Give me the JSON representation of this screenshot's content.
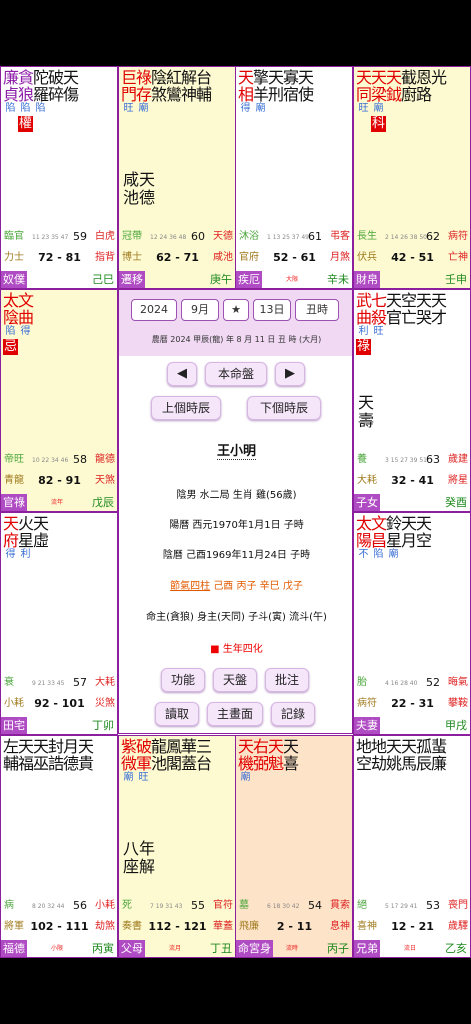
{
  "palaces": [
    {
      "stars": [
        {
          "c": "廉貞",
          "t": "purple",
          "b": "陷"
        },
        {
          "c": "貪狼",
          "t": "purple",
          "b": "陷",
          "h": "權"
        },
        {
          "c": "陀羅",
          "t": "black",
          "b": "陷"
        },
        {
          "c": "破碎",
          "t": "black",
          "b": ""
        },
        {
          "c": "天傷",
          "t": "black",
          "b": ""
        }
      ],
      "minor": "",
      "stage": "臨官",
      "ages": "11 23 35 47",
      "age": "59",
      "god1": "白虎",
      "doc": "力士",
      "range": "72 - 81",
      "god2": "指背",
      "palace": "奴僕",
      "mid": "",
      "gz": "己巳",
      "bg": "white"
    },
    {
      "stars": [
        {
          "c": "巨門",
          "t": "red",
          "b": "旺"
        },
        {
          "c": "祿存",
          "t": "red",
          "b": "廟"
        },
        {
          "c": "陰煞",
          "t": "black",
          "b": ""
        },
        {
          "c": "紅鸞",
          "t": "black",
          "b": ""
        },
        {
          "c": "解神",
          "t": "black",
          "b": ""
        },
        {
          "c": "台輔",
          "t": "black",
          "b": ""
        }
      ],
      "minor": "咸天\n池德",
      "stage": "冠帶",
      "ages": "12 24 36 48",
      "age": "60",
      "god1": "天德",
      "doc": "博士",
      "range": "62 - 71",
      "god2": "咸池",
      "palace": "遷移",
      "mid": "",
      "gz": "庚午",
      "bg": "yellow"
    },
    {
      "stars": [
        {
          "c": "天相",
          "t": "red",
          "b": "得"
        },
        {
          "c": "擎羊",
          "t": "black",
          "b": "廟"
        },
        {
          "c": "天刑",
          "t": "black",
          "b": ""
        },
        {
          "c": "寡宿",
          "t": "black",
          "b": ""
        },
        {
          "c": "天使",
          "t": "black",
          "b": ""
        }
      ],
      "minor": "",
      "stage": "沐浴",
      "ages": "1 13 25 37 49",
      "age": "61",
      "god1": "弔客",
      "doc": "官府",
      "range": "52 - 61",
      "god2": "月煞",
      "palace": "疾厄",
      "mid": "大限",
      "gz": "辛未",
      "bg": "white"
    },
    {
      "stars": [
        {
          "c": "天同",
          "t": "red",
          "b": "旺"
        },
        {
          "c": "天梁",
          "t": "red",
          "b": "廟",
          "h": "科"
        },
        {
          "c": "天鉞",
          "t": "red",
          "b": ""
        },
        {
          "c": "截廚",
          "t": "black",
          "b": ""
        },
        {
          "c": "恩路",
          "t": "black",
          "b": ""
        },
        {
          "c": "光",
          "t": "black",
          "b": ""
        }
      ],
      "minor": "",
      "stage": "長生",
      "ages": "2 14 26 38 50",
      "age": "62",
      "god1": "病符",
      "doc": "伏兵",
      "range": "42 - 51",
      "god2": "亡神",
      "palace": "財帛",
      "mid": "",
      "gz": "壬申",
      "bg": "yellow"
    },
    {
      "stars": [
        {
          "c": "太陰",
          "t": "red",
          "b": "陷",
          "h": "忌"
        },
        {
          "c": "文曲",
          "t": "red",
          "b": "得"
        }
      ],
      "minor": "",
      "stage": "帝旺",
      "ages": "10 22 34 46",
      "age": "58",
      "god1": "龍德",
      "doc": "青龍",
      "range": "82 - 91",
      "god2": "天煞",
      "palace": "官祿",
      "mid": "流年",
      "gz": "戊辰",
      "bg": "yellow"
    },
    {
      "stars": [
        {
          "c": "武曲",
          "t": "red",
          "b": "利",
          "h": "祿"
        },
        {
          "c": "七殺",
          "t": "red",
          "b": "旺"
        },
        {
          "c": "天官",
          "t": "black",
          "b": ""
        },
        {
          "c": "空亡",
          "t": "black",
          "b": ""
        },
        {
          "c": "天哭",
          "t": "black",
          "b": ""
        },
        {
          "c": "天才",
          "t": "black",
          "b": ""
        }
      ],
      "minor": "天\n壽",
      "stage": "養",
      "ages": "3 15 27 39 51",
      "age": "63",
      "god1": "歲建",
      "doc": "大耗",
      "range": "32 - 41",
      "god2": "將星",
      "palace": "子女",
      "mid": "",
      "gz": "癸酉",
      "bg": "white"
    },
    {
      "stars": [
        {
          "c": "天府",
          "t": "red",
          "b": "得"
        },
        {
          "c": "火星",
          "t": "black",
          "b": "利"
        },
        {
          "c": "天虛",
          "t": "black",
          "b": ""
        }
      ],
      "minor": "",
      "stage": "衰",
      "ages": "9 21 33 45",
      "age": "57",
      "god1": "大耗",
      "doc": "小耗",
      "range": "92 - 101",
      "god2": "災煞",
      "palace": "田宅",
      "mid": "",
      "gz": "丁卯",
      "bg": "white"
    },
    {
      "stars": [
        {
          "c": "太陽",
          "t": "red",
          "b": "不"
        },
        {
          "c": "文昌",
          "t": "red",
          "b": "陷"
        },
        {
          "c": "鈴星",
          "t": "black",
          "b": "廟"
        },
        {
          "c": "天月",
          "t": "black",
          "b": ""
        },
        {
          "c": "天空",
          "t": "black",
          "b": ""
        }
      ],
      "minor": "",
      "stage": "胎",
      "ages": "4 16 28 40",
      "age": "52",
      "god1": "晦氣",
      "doc": "病符",
      "range": "22 - 31",
      "god2": "攀鞍",
      "palace": "夫妻",
      "mid": "",
      "gz": "甲戌",
      "bg": "white"
    },
    {
      "stars": [
        {
          "c": "左輔",
          "t": "black",
          "b": ""
        },
        {
          "c": "天福",
          "t": "black",
          "b": ""
        },
        {
          "c": "天巫",
          "t": "black",
          "b": ""
        },
        {
          "c": "封誥",
          "t": "black",
          "b": ""
        },
        {
          "c": "月德",
          "t": "black",
          "b": ""
        },
        {
          "c": "天貴",
          "t": "black",
          "b": ""
        }
      ],
      "minor": "",
      "stage": "病",
      "ages": "8 20 32 44",
      "age": "56",
      "god1": "小耗",
      "doc": "將軍",
      "range": "102 - 111",
      "god2": "劫煞",
      "palace": "福德",
      "mid": "小限",
      "gz": "丙寅",
      "bg": "white"
    },
    {
      "stars": [
        {
          "c": "紫微",
          "t": "red",
          "b": "廟"
        },
        {
          "c": "破軍",
          "t": "red",
          "b": "旺"
        },
        {
          "c": "龍池",
          "t": "black",
          "b": ""
        },
        {
          "c": "鳳閣",
          "t": "black",
          "b": ""
        },
        {
          "c": "華蓋",
          "t": "black",
          "b": ""
        },
        {
          "c": "三台",
          "t": "black",
          "b": ""
        }
      ],
      "minor": "八年\n座解",
      "stage": "死",
      "ages": "7 19 31 43",
      "age": "55",
      "god1": "官符",
      "doc": "奏書",
      "range": "112 - 121",
      "god2": "華蓋",
      "palace": "父母",
      "mid": "流月",
      "gz": "丁丑",
      "bg": "yellow"
    },
    {
      "stars": [
        {
          "c": "天機",
          "t": "red",
          "b": "廟"
        },
        {
          "c": "右弼",
          "t": "red",
          "b": ""
        },
        {
          "c": "天魁",
          "t": "red",
          "b": ""
        },
        {
          "c": "天喜",
          "t": "black",
          "b": ""
        }
      ],
      "minor": "",
      "stage": "墓",
      "ages": "6 18 30 42",
      "age": "54",
      "god1": "貫索",
      "doc": "飛廉",
      "range": "2 - 11",
      "god2": "息神",
      "palace": "命宮身",
      "mid": "流時",
      "gz": "丙子",
      "bg": "orange"
    },
    {
      "stars": [
        {
          "c": "地空",
          "t": "black",
          "b": ""
        },
        {
          "c": "地劫",
          "t": "black",
          "b": ""
        },
        {
          "c": "天姚",
          "t": "black",
          "b": ""
        },
        {
          "c": "天馬",
          "t": "black",
          "b": ""
        },
        {
          "c": "孤辰",
          "t": "black",
          "b": ""
        },
        {
          "c": "蜚廉",
          "t": "black",
          "b": ""
        }
      ],
      "minor": "",
      "stage": "絕",
      "ages": "5 17 29 41",
      "age": "53",
      "god1": "喪門",
      "doc": "喜神",
      "range": "12 - 21",
      "god2": "歲驛",
      "palace": "兄弟",
      "mid": "流日",
      "gz": "乙亥",
      "bg": "white"
    }
  ],
  "center": {
    "year": "2024",
    "month": "9月",
    "star": "★",
    "day": "13日",
    "hour": "丑時",
    "lunar": "農曆 2024 甲辰(龍) 年 8 月 11 日 丑 時 (大月)",
    "prev": "◀",
    "mode": "本命盤",
    "next": "▶",
    "prevHour": "上個時辰",
    "nextHour": "下個時辰",
    "name": "王小明",
    "line1": "陰男 水二局 生肖 雞(56歲)",
    "line2": "陽曆 西元1970年1月1日 子時",
    "line3": "陰曆 己酉1969年11月24日 子時",
    "pillarsLabel": "節氣四柱",
    "pillars": "己酉 丙子 辛巳 戊子",
    "line5": "命主(貪狼) 身主(天同) 子斗(寅) 流斗(午)",
    "legend": "■ 生年四化",
    "b1": "功能",
    "b2": "天盤",
    "b3": "批注",
    "b4": "讀取",
    "b5": "主畫面",
    "b6": "記錄"
  }
}
